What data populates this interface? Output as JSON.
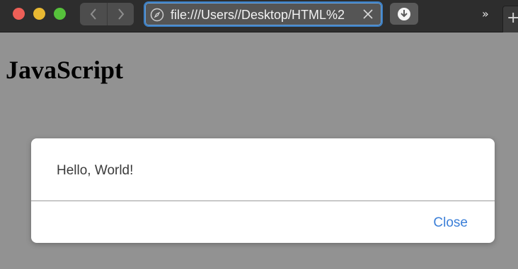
{
  "toolbar": {
    "address_url": "file:///Users//Desktop/HTML%2",
    "icons": {
      "back": "chevron-left-icon",
      "forward": "chevron-right-icon",
      "compass": "compass-icon",
      "clear": "close-icon",
      "download": "download-icon",
      "more": "chevron-double-right-icon",
      "new_tab": "plus-icon"
    },
    "more_label": "»",
    "new_tab_label": "+"
  },
  "page": {
    "title": "JavaScript"
  },
  "dialog": {
    "message": "Hello, World!",
    "close_label": "Close"
  },
  "colors": {
    "accent": "#3b7fd8",
    "traffic_red": "#ed5f57",
    "traffic_yellow": "#e9b932",
    "traffic_green": "#56c13b",
    "page_overlay": "#929292"
  }
}
